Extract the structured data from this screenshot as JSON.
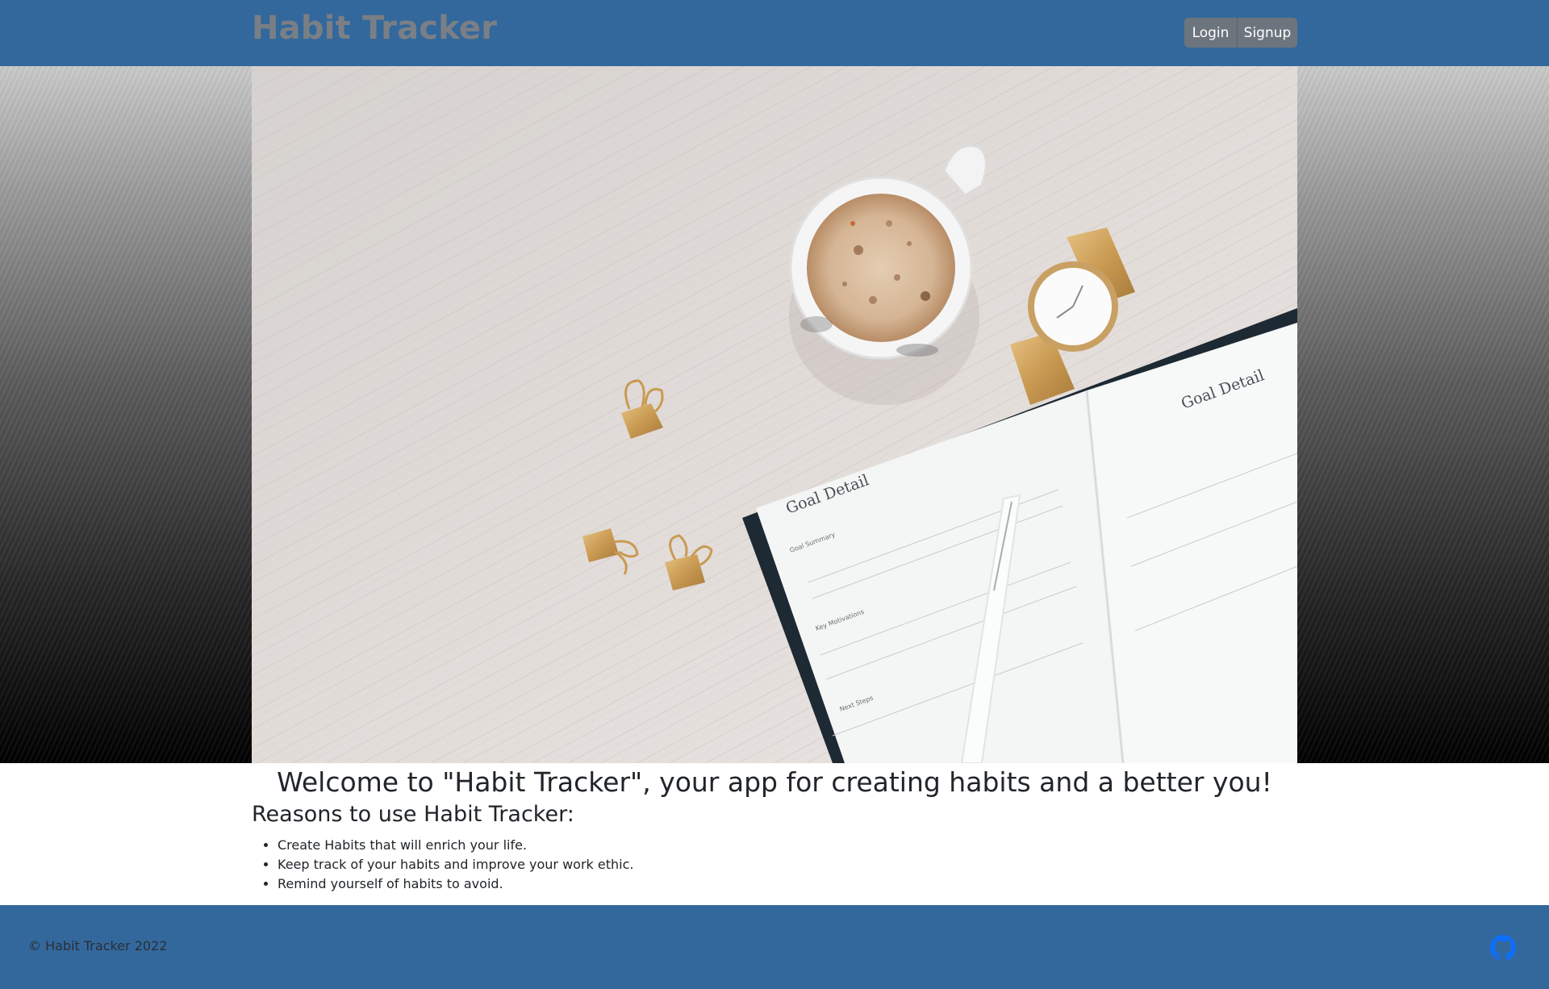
{
  "header": {
    "brand": "Habit Tracker",
    "login_label": "Login",
    "signup_label": "Signup"
  },
  "hero": {
    "image": "hero-photo",
    "notebook_heading": "Goal Detail",
    "notebook_sections": [
      "Goal Summary",
      "Key Motivations",
      "Next Steps"
    ]
  },
  "main": {
    "welcome": "Welcome to \"Habit Tracker\", your app for creating habits and a better you!",
    "reasons_title": "Reasons to use Habit Tracker:",
    "reasons": [
      "Create Habits that will enrich your life.",
      "Keep track of your habits and improve your work ethic.",
      "Remind yourself of habits to avoid."
    ]
  },
  "footer": {
    "copyright": "© Habit Tracker 2022",
    "github_icon": "github-icon"
  },
  "colors": {
    "header_bg": "#33689c",
    "footer_bg": "#33689c",
    "brand_text": "#7a7f86",
    "button_bg": "#6c757d",
    "github_icon": "#0d6efd"
  }
}
